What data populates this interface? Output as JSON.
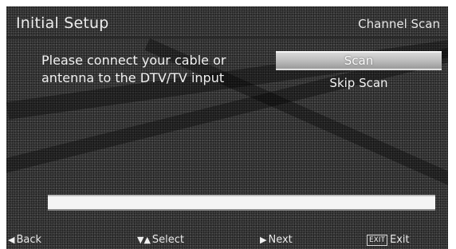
{
  "header": {
    "title": "Initial Setup",
    "section": "Channel Scan"
  },
  "main": {
    "message_lines": [
      "Please connect your cable or",
      "antenna to the DTV/TV input"
    ],
    "buttons": {
      "scan": "Scan",
      "skip_scan": "Skip Scan"
    },
    "progress": {
      "fraction": 1.0
    }
  },
  "footer": {
    "back": {
      "icon": "left-arrow-icon",
      "label": "Back"
    },
    "select": {
      "icon": "up-down-arrow-icon",
      "label": "Select"
    },
    "next": {
      "icon": "right-arrow-icon",
      "label": "Next"
    },
    "exit": {
      "key": "EXIT",
      "label": "Exit"
    }
  },
  "colors": {
    "background": "#3f3f3f",
    "highlight": "#c8c8c8",
    "text": "#f0f0f0"
  }
}
